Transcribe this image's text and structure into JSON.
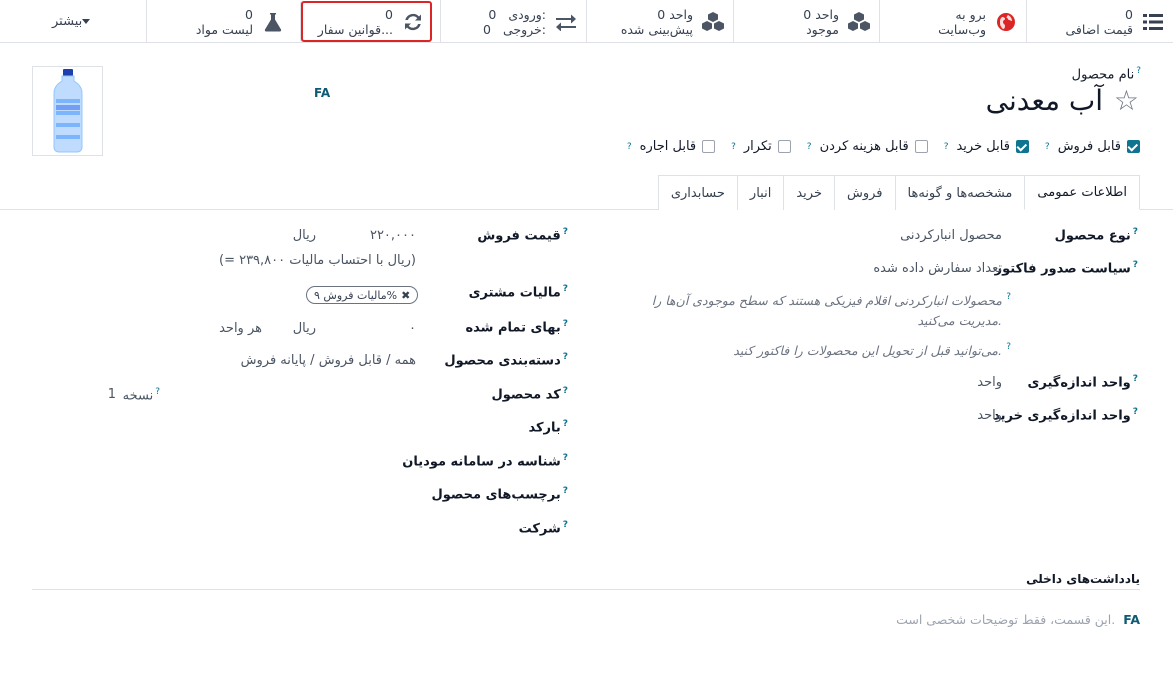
{
  "smart_buttons": {
    "extra_price": {
      "value": "0",
      "label": "قیمت اضافی",
      "icon": "list-icon"
    },
    "website": {
      "line1": "برو به",
      "line2": "وب‌سایت",
      "icon": "globe-icon"
    },
    "on_hand": {
      "line1": "0 واحد",
      "line2": "موجود",
      "icon": "cubes-icon"
    },
    "forecasted": {
      "line1": "0 واحد",
      "line2": "پیش‌بینی شده",
      "icon": "cubes-icon"
    },
    "in_out": {
      "in_label": "ورودی:",
      "in_value": "0",
      "out_label": "خروجی:",
      "out_value": "0",
      "icon": "exchange-icon"
    },
    "reorder": {
      "value": "0",
      "label": "قوانین سفار...",
      "icon": "refresh-icon"
    },
    "bom": {
      "value": "0",
      "label": "لیست مواد",
      "icon": "flask-icon"
    },
    "more": {
      "label": "بیشتر"
    }
  },
  "product": {
    "name_label": "نام محصول",
    "name": "آب معدنی",
    "lang": "FA",
    "checkboxes": [
      {
        "label": "قابل فروش",
        "checked": true
      },
      {
        "label": "قابل خرید",
        "checked": true
      },
      {
        "label": "قابل هزینه کردن",
        "checked": false
      },
      {
        "label": "تکرار",
        "checked": false
      },
      {
        "label": "قابل اجاره",
        "checked": false
      }
    ]
  },
  "tabs": [
    "اطلاعات عمومی",
    "مشخصه‌ها و گونه‌ها",
    "فروش",
    "خرید",
    "انبار",
    "حسابداری"
  ],
  "general": {
    "product_type": {
      "label": "نوع محصول",
      "value": "محصول انبارکردنی"
    },
    "invoice_policy": {
      "label": "سیاست صدور فاکتور",
      "value": "تعداد سفارش داده شده"
    },
    "hint1": "محصولات انبارکردنی اقلام فیزیکی هستند که سطح موجودی آن‌ها را مدیریت می‌کنید.",
    "hint2": "می‌توانید قبل از تحویل این محصولات را فاکتور کنید.",
    "uom": {
      "label": "واحد اندازه‌گیری",
      "value": "واحد"
    },
    "purchase_uom": {
      "label": "واحد اندازه‌گیری خرید",
      "value": "واحد"
    },
    "sales_price": {
      "label": "قیمت فروش",
      "value": "۲۲۰,۰۰۰",
      "currency": "ریال"
    },
    "price_with_tax": "(= ۲۳۹,۸۰۰ ریال با احتساب مالیات)",
    "customer_taxes": {
      "label": "مالیات مشتری",
      "tag": "مالیات فروش ۹%"
    },
    "cost": {
      "label": "بهای تمام شده",
      "value": "۰",
      "currency": "ریال",
      "per": "هر واحد"
    },
    "category": {
      "label": "دسته‌بندی محصول",
      "value": "همه / قابل فروش / پایانه فروش"
    },
    "internal_ref": {
      "label": "کد محصول",
      "version_label": "نسخه",
      "version_value": "1"
    },
    "barcode": {
      "label": "بارکد"
    },
    "moodian_id": {
      "label": "شناسه در سامانه مودیان"
    },
    "tags": {
      "label": "برچسب‌های محصول"
    },
    "company": {
      "label": "شرکت"
    }
  },
  "notes": {
    "title": "یادداشت‌های داخلی",
    "lang": "FA",
    "placeholder": "این قسمت، فقط توضیحات شخصی است."
  }
}
